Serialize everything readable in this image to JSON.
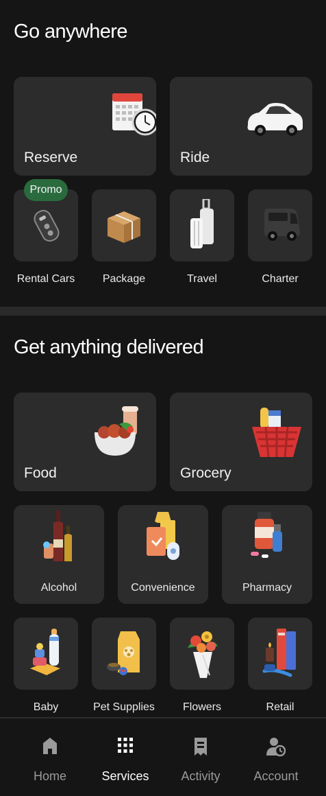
{
  "go_anywhere": {
    "title": "Go anywhere",
    "large_tiles": [
      {
        "label": "Reserve",
        "icon": "calendar-clock-icon"
      },
      {
        "label": "Ride",
        "icon": "car-icon"
      }
    ],
    "small_tiles": [
      {
        "label": "Rental Cars",
        "icon": "car-key-icon",
        "badge": "Promo"
      },
      {
        "label": "Package",
        "icon": "package-box-icon"
      },
      {
        "label": "Travel",
        "icon": "luggage-icon"
      },
      {
        "label": "Charter",
        "icon": "van-icon"
      }
    ]
  },
  "delivered": {
    "title": "Get anything delivered",
    "large_tiles": [
      {
        "label": "Food",
        "icon": "food-bowl-icon"
      },
      {
        "label": "Grocery",
        "icon": "grocery-basket-icon"
      }
    ],
    "mid_tiles": [
      {
        "label": "Alcohol",
        "icon": "wine-bottles-icon"
      },
      {
        "label": "Convenience",
        "icon": "convenience-bag-icon"
      },
      {
        "label": "Pharmacy",
        "icon": "pharmacy-bottles-icon"
      }
    ],
    "small_tiles": [
      {
        "label": "Baby",
        "icon": "baby-bottle-icon"
      },
      {
        "label": "Pet Supplies",
        "icon": "pet-food-icon"
      },
      {
        "label": "Flowers",
        "icon": "flower-bouquet-icon"
      },
      {
        "label": "Retail",
        "icon": "books-icon"
      }
    ]
  },
  "nav": {
    "items": [
      {
        "label": "Home",
        "icon": "home-icon"
      },
      {
        "label": "Services",
        "icon": "grid-icon",
        "active": true
      },
      {
        "label": "Activity",
        "icon": "receipt-icon"
      },
      {
        "label": "Account",
        "icon": "account-icon"
      }
    ]
  },
  "colors": {
    "background": "#151515",
    "tile": "#2c2c2c",
    "promo_badge": "#2a6b3e",
    "inactive_text": "#9a9a9a"
  }
}
